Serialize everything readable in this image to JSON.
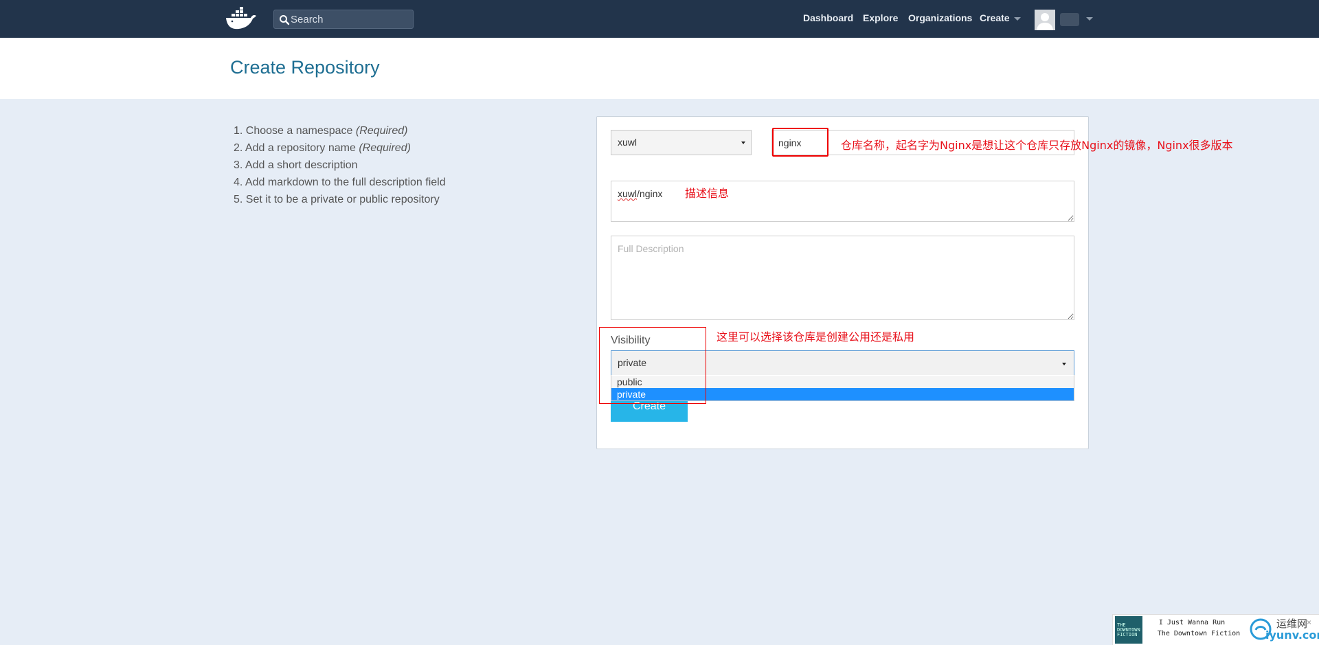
{
  "nav": {
    "search_placeholder": "Search",
    "links": [
      "Dashboard",
      "Explore",
      "Organizations",
      "Create"
    ]
  },
  "page": {
    "title": "Create Repository"
  },
  "steps": [
    {
      "text": "1. Choose a namespace ",
      "em": "(Required)"
    },
    {
      "text": "2. Add a repository name ",
      "em": "(Required)"
    },
    {
      "text": "3. Add a short description",
      "em": ""
    },
    {
      "text": "4. Add markdown to the full description field",
      "em": ""
    },
    {
      "text": "5. Set it to be a private or public repository",
      "em": ""
    }
  ],
  "form": {
    "namespace_value": "xuwl",
    "repo_name_value": "nginx",
    "short_description_prefix": "xuwl",
    "short_description_suffix": "/nginx",
    "full_description_placeholder": "Full Description",
    "visibility_label": "Visibility",
    "visibility_value": "private",
    "visibility_options": [
      "public",
      "private"
    ],
    "create_label": "Create"
  },
  "annotations": {
    "repo_name_note": "仓库名称，起名字为Nginx是想让这个仓库只存放Nginx的镜像，Nginx很多版本",
    "description_note": "描述信息",
    "visibility_note": "这里可以选择该仓库是创建公用还是私用"
  },
  "music_widget": {
    "song": "I Just Wanna Run",
    "artist": "The Downtown Fiction",
    "album_text": "THE DOWNTOWN FICTION",
    "watermark": "运维网",
    "watermark_site": "iyunv.com",
    "close": "×"
  },
  "colors": {
    "nav_bg": "#22344b",
    "title": "#1e6e92",
    "button": "#27b5e8",
    "annotation": "#e8111b",
    "selected_option": "#1e90ff"
  }
}
